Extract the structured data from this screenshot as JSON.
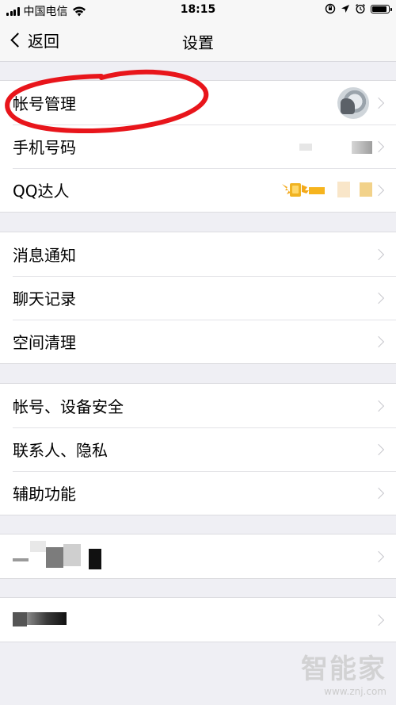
{
  "status_bar": {
    "carrier": "中国电信",
    "time": "18:15",
    "battery_level": 0.95
  },
  "nav": {
    "back_label": "返回",
    "title": "设置"
  },
  "groups": [
    {
      "rows": [
        {
          "label": "帐号管理",
          "accessory": "avatar"
        },
        {
          "label": "手机号码",
          "accessory": "redacted"
        },
        {
          "label": "QQ达人",
          "accessory": "qq-badge"
        }
      ]
    },
    {
      "rows": [
        {
          "label": "消息通知"
        },
        {
          "label": "聊天记录"
        },
        {
          "label": "空间清理"
        }
      ]
    },
    {
      "rows": [
        {
          "label": "帐号、设备安全"
        },
        {
          "label": "联系人、隐私"
        },
        {
          "label": "辅助功能"
        }
      ]
    }
  ],
  "colors": {
    "annotation": "#e8151b",
    "background": "#efeff4",
    "chevron": "#c7c7cc"
  },
  "watermark": {
    "text": "智能家",
    "url": "www.znj.com"
  }
}
